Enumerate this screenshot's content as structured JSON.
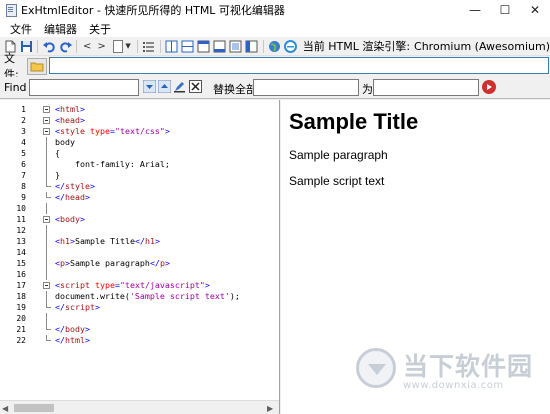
{
  "window": {
    "title": "ExHtmlEditor - 快速所见所得的 HTML 可视化编辑器",
    "minimize": "—",
    "maximize": "☐",
    "close": "✕"
  },
  "menu": {
    "items": [
      {
        "label": "文件"
      },
      {
        "label": "编辑器"
      },
      {
        "label": "关于"
      }
    ]
  },
  "toolbar": {
    "back_glyph": "<",
    "forward_glyph": ">",
    "combo_arrow": "▼",
    "render_engine_label": "当前 HTML 渲染引擎:",
    "render_engine_value": "Chromium (Awesomium)"
  },
  "filebar": {
    "label": "文件:",
    "path_value": ""
  },
  "findbar": {
    "find_label": "Find",
    "find_value": "",
    "replace_all_label": "替换全部",
    "replace_value": "",
    "as_label": "为",
    "with_value": ""
  },
  "editor": {
    "line_numbers": [
      "1",
      "2",
      "3",
      "4",
      "5",
      "6",
      "7",
      "8",
      "9",
      "10",
      "11",
      "12",
      "13",
      "14",
      "15",
      "16",
      "17",
      "18",
      "19",
      "20",
      "21",
      "22"
    ],
    "scroll_left": "◀",
    "scroll_right": "▶"
  },
  "preview": {
    "heading": "Sample Title",
    "paragraph": "Sample paragraph",
    "script_output": "Sample script text"
  },
  "watermark": {
    "brand": "当下软件园",
    "url": "www.downxia.com"
  },
  "colors": {
    "tag": "#0000ff",
    "tagname": "#a31515",
    "attr": "#ff0000",
    "string": "#a000a0",
    "input_focus_border": "#3c7fb1",
    "go_button": "#d0302a"
  }
}
